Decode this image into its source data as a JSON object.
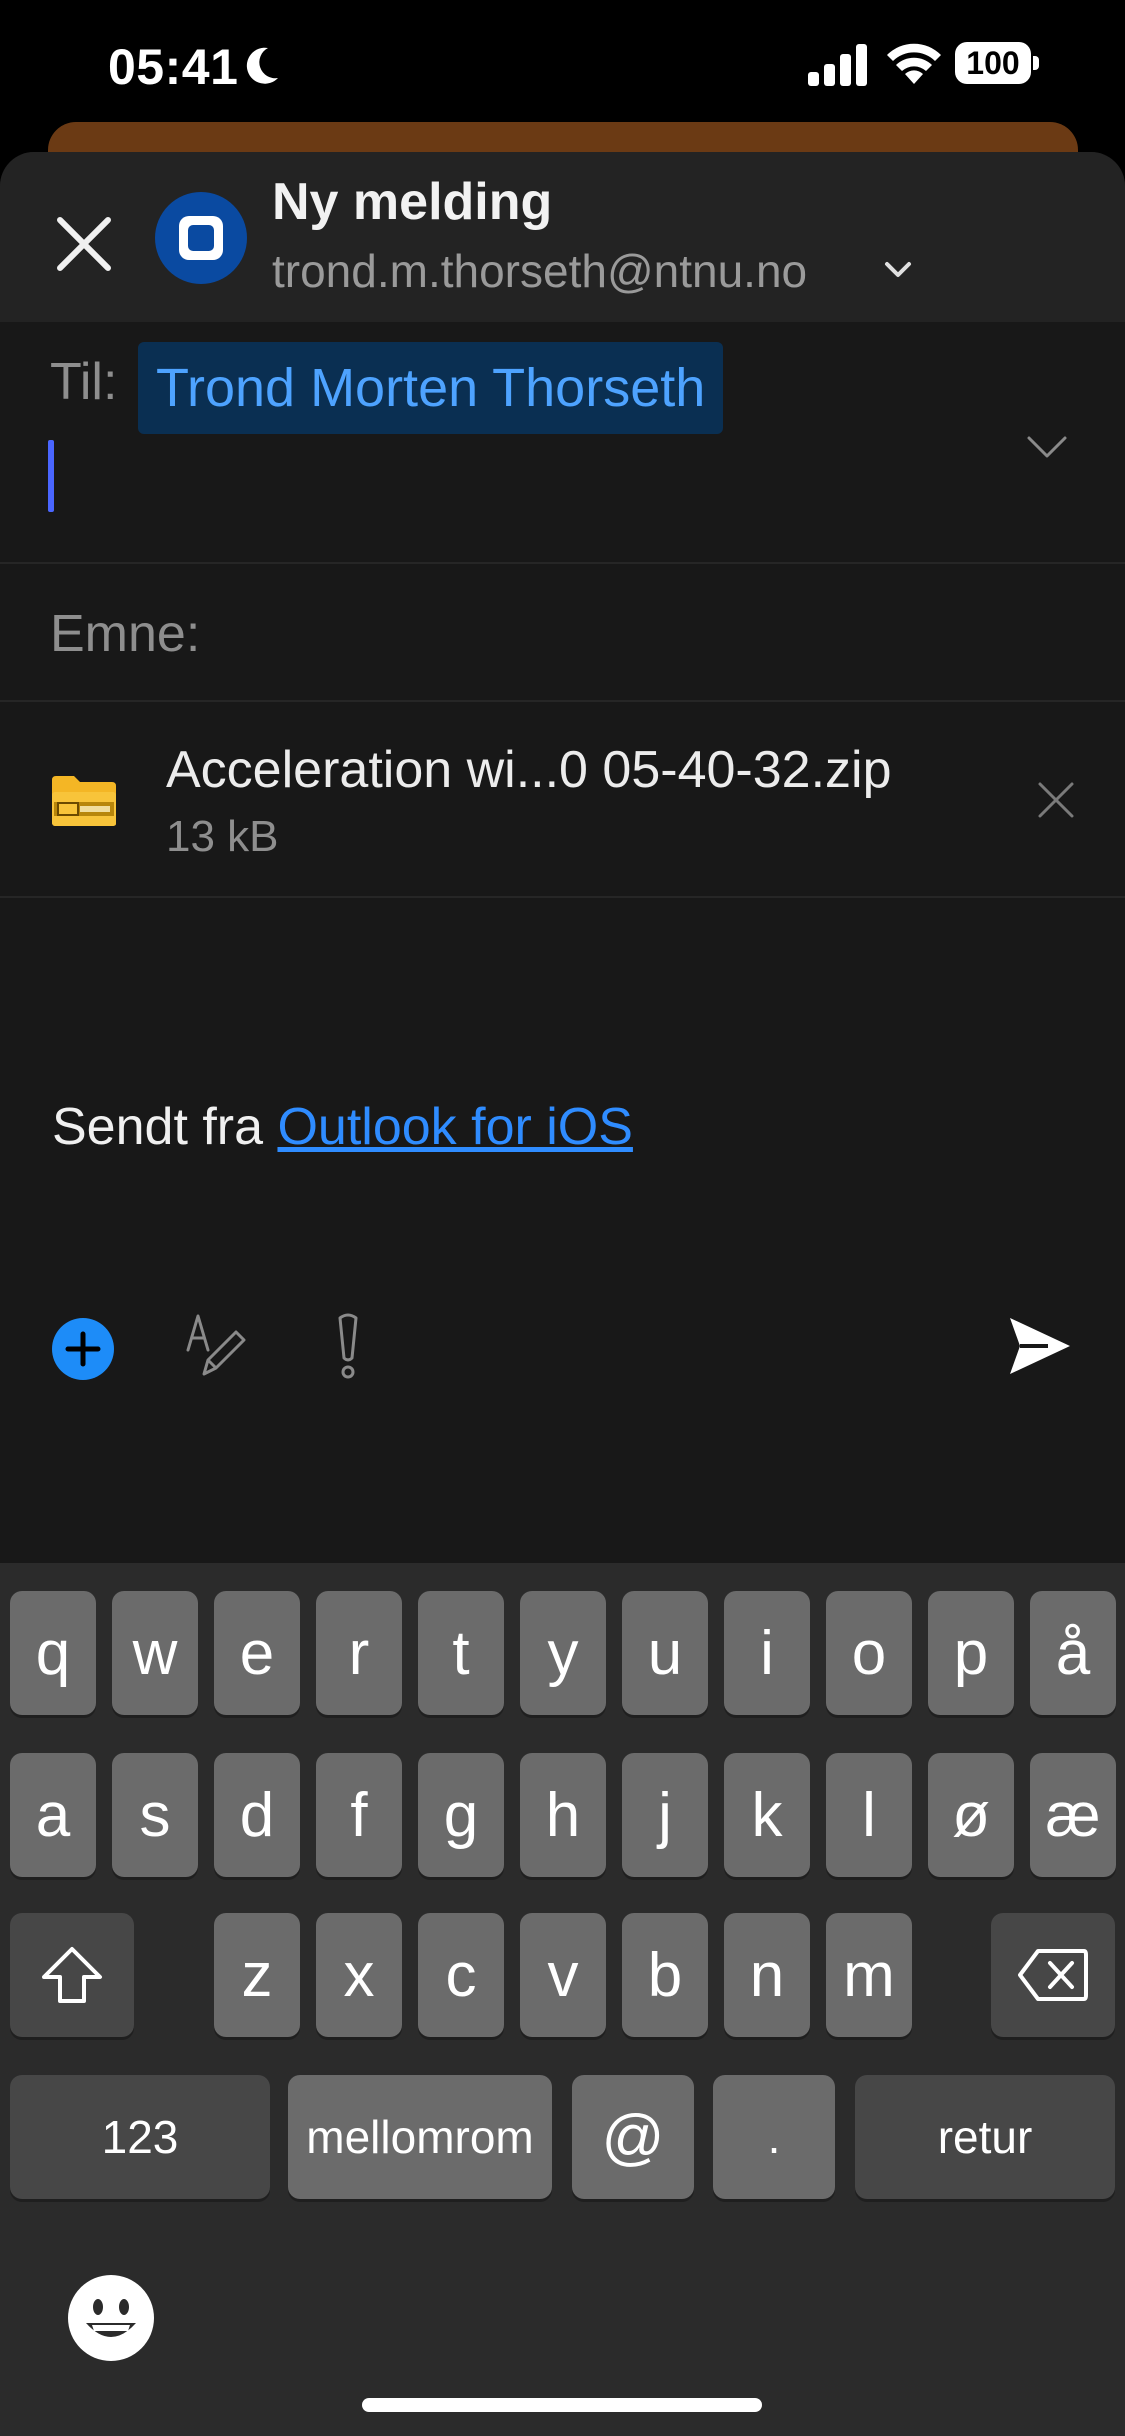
{
  "status_bar": {
    "time": "05:41",
    "battery": "100"
  },
  "compose": {
    "title": "Ny melding",
    "from_account": "trond.m.thorseth@ntnu.no",
    "to_label": "Til:",
    "recipient": "Trond Morten Thorseth",
    "subject_label": "Emne:",
    "attachment": {
      "name": "Acceleration wi...0 05-40-32.zip",
      "size": "13 kB"
    },
    "signature_prefix": "Sendt fra ",
    "signature_link": "Outlook for iOS"
  },
  "keyboard": {
    "row1": [
      "q",
      "w",
      "e",
      "r",
      "t",
      "y",
      "u",
      "i",
      "o",
      "p",
      "å"
    ],
    "row2": [
      "a",
      "s",
      "d",
      "f",
      "g",
      "h",
      "j",
      "k",
      "l",
      "ø",
      "æ"
    ],
    "row3": [
      "z",
      "x",
      "c",
      "v",
      "b",
      "n",
      "m"
    ],
    "numbers_label": "123",
    "space_label": "mellomrom",
    "at_label": "@",
    "dot_label": ".",
    "return_label": "retur"
  },
  "colors": {
    "accent": "#1d8cf8",
    "link": "#2f8cff",
    "recipient_chip": "#0a2f52",
    "avatar": "#0a4aa1"
  }
}
